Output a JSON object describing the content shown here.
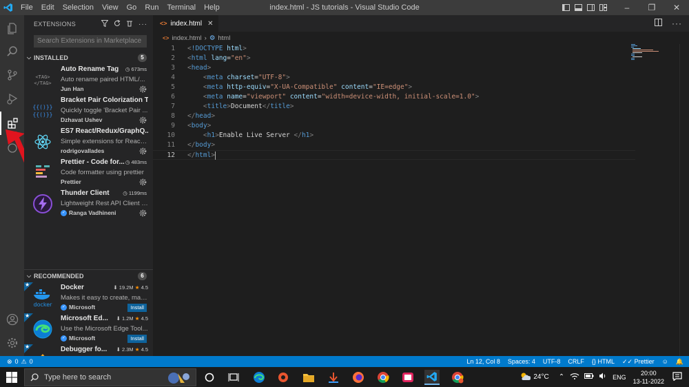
{
  "titlebar": {
    "menu": [
      "File",
      "Edit",
      "Selection",
      "View",
      "Go",
      "Run",
      "Terminal",
      "Help"
    ],
    "window_title": "index.html - JS tutorials - Visual Studio Code"
  },
  "activity_bar": {
    "items": [
      "explorer-icon",
      "search-icon",
      "source-control-icon",
      "run-debug-icon",
      "extensions-icon",
      "remote-icon"
    ],
    "bottom": [
      "account-icon",
      "manage-gear-icon"
    ]
  },
  "sidebar": {
    "title": "EXTENSIONS",
    "search_placeholder": "Search Extensions in Marketplace",
    "installed": {
      "label": "INSTALLED",
      "count": "5",
      "items": [
        {
          "name": "Auto Rename Tag",
          "time": "673ms",
          "desc": "Auto rename paired HTML/...",
          "publisher": "Jun Han"
        },
        {
          "name": "Bracket Pair Colorization T...",
          "time": "",
          "desc": "Quickly toggle 'Bracket Pair ...",
          "publisher": "Dzhavat Ushev"
        },
        {
          "name": "ES7 React/Redux/GraphQ...",
          "time": "",
          "desc": "Simple extensions for React,...",
          "publisher": "rodrigovallades"
        },
        {
          "name": "Prettier - Code for...",
          "time": "483ms",
          "desc": "Code formatter using prettier",
          "publisher": "Prettier"
        },
        {
          "name": "Thunder Client",
          "time": "1199ms",
          "desc": "Lightweight Rest API Client f...",
          "publisher": "Ranga Vadhineni"
        }
      ]
    },
    "recommended": {
      "label": "RECOMMENDED",
      "count": "6",
      "items": [
        {
          "name": "Docker",
          "downloads": "19.2M",
          "rating": "4.5",
          "desc": "Makes it easy to create, man...",
          "publisher": "Microsoft",
          "install": "Install"
        },
        {
          "name": "Microsoft Ed...",
          "downloads": "1.2M",
          "rating": "4.5",
          "desc": "Use the Microsoft Edge Tool...",
          "publisher": "Microsoft",
          "install": "Install"
        },
        {
          "name": "Debugger fo...",
          "downloads": "2.3M",
          "rating": "4.5",
          "desc": "",
          "publisher": "",
          "install": ""
        }
      ]
    }
  },
  "editor": {
    "tab_label": "index.html",
    "breadcrumb": [
      "index.html",
      "html"
    ],
    "cursor_line": "12",
    "line_numbers": [
      "1",
      "2",
      "3",
      "4",
      "5",
      "6",
      "7",
      "8",
      "9",
      "10",
      "11",
      "12"
    ]
  },
  "statusbar": {
    "problems_errors": "0",
    "problems_warnings": "0",
    "position": "Ln 12, Col 8",
    "spaces": "Spaces: 4",
    "encoding": "UTF-8",
    "eol": "CRLF",
    "language": "HTML",
    "formatter": "Prettier"
  },
  "taskbar": {
    "search_placeholder": "Type here to search",
    "weather": "24°C",
    "language": "ENG",
    "time": "20:00",
    "date": "13-11-2022"
  },
  "colors": {
    "accent": "#007acc",
    "annotation_arrow": "#e0141e"
  }
}
